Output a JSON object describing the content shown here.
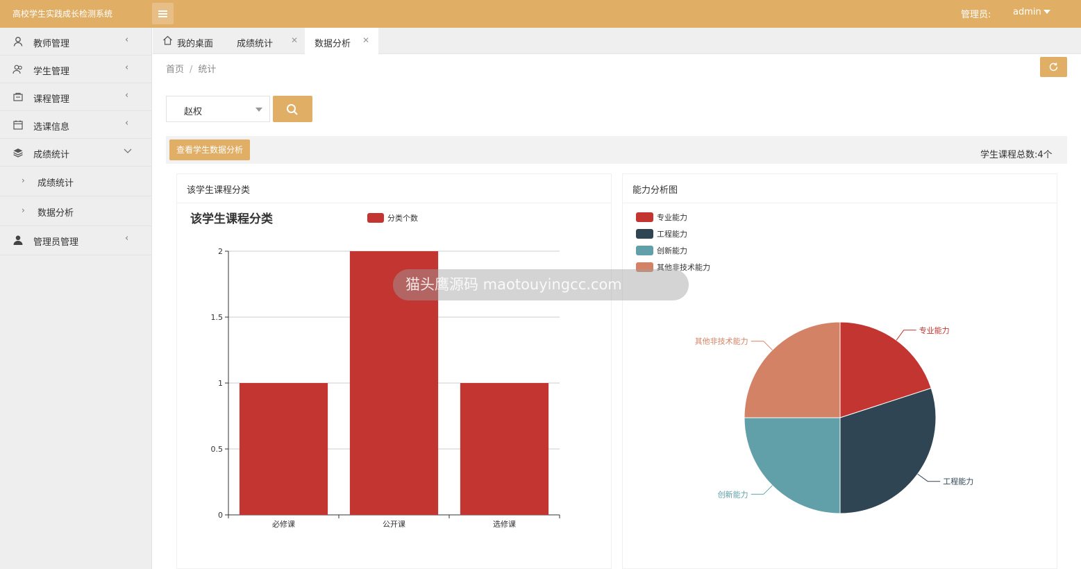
{
  "header": {
    "app_title": "高校学生实践成长检测系统",
    "admin_label": "管理员:",
    "admin_name": "admin"
  },
  "sidebar": {
    "items": [
      {
        "label": "教师管理",
        "icon": "user-icon"
      },
      {
        "label": "学生管理",
        "icon": "users-icon"
      },
      {
        "label": "课程管理",
        "icon": "course-icon"
      },
      {
        "label": "选课信息",
        "icon": "calendar-icon"
      },
      {
        "label": "成绩统计",
        "icon": "layers-icon",
        "expanded": true
      }
    ],
    "sub_items": [
      {
        "label": "成绩统计"
      },
      {
        "label": "数据分析"
      }
    ],
    "last_item": {
      "label": "管理员管理",
      "icon": "admin-icon"
    }
  },
  "tabs": [
    {
      "label": "我的桌面",
      "icon": "home-icon"
    },
    {
      "label": "成绩统计"
    },
    {
      "label": "数据分析",
      "active": true
    }
  ],
  "breadcrumb": {
    "home": "首页",
    "current": "统计"
  },
  "search": {
    "selected_student": "赵权"
  },
  "toolbar": {
    "view_button": "查看学生数据分析",
    "total_label": "学生课程总数:4个"
  },
  "panels": {
    "left_title": "该学生课程分类",
    "right_title": "能力分析图"
  },
  "watermark": "猫头鹰源码 maotouyingcc.com",
  "colors": {
    "accent": "#e0ae64",
    "bar": "#c23531",
    "slices": [
      "#c23531",
      "#2f4554",
      "#61a0a8",
      "#d48265"
    ]
  },
  "chart_data": [
    {
      "type": "bar",
      "title": "该学生课程分类",
      "categories": [
        "必修课",
        "公开课",
        "选修课"
      ],
      "series": [
        {
          "name": "分类个数",
          "values": [
            1,
            2,
            1
          ]
        }
      ],
      "yticks": [
        "0",
        "0.5",
        "1",
        "1.5",
        "2"
      ],
      "ylim": [
        0,
        2
      ],
      "legend": "top-center",
      "grid": true
    },
    {
      "type": "pie",
      "labels": [
        "专业能力",
        "工程能力",
        "创新能力",
        "其他非技术能力"
      ],
      "values": [
        20,
        30,
        25,
        25
      ],
      "legend": "top-left"
    }
  ]
}
